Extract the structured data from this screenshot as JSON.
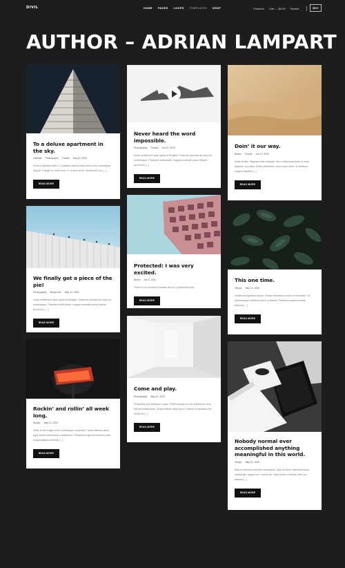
{
  "header": {
    "logo": "DIVIL",
    "nav": [
      "HOME",
      "PAGES",
      "LOOPS",
      "TEMPLATES",
      "SHOP"
    ],
    "right": [
      "Features",
      "Cart — $0.00",
      "Search"
    ],
    "buy": "BUY"
  },
  "page_title": "AUTHOR – ADRIAN LAMPART",
  "read_more": "READ MORE",
  "cards": [
    {
      "title": "To a deluxe apartment in the sky.",
      "meta": [
        "Lifestyle",
        "Photography",
        "Travels",
        "Aug 10, 2020"
      ],
      "excerpt": "Proin id gravida libero. Curabitur lacinia tellus sed purus consequat aliquet. Integer eu ante eros. In a arcu tortor. Vestibulum ac [...]"
    },
    {
      "title": "We finally got a piece of the pie!",
      "meta": [
        "Photography",
        "Simple Mix",
        "May 14, 2020"
      ],
      "excerpt": "Nulla vestibulum quis ligula at fringilla. Vivamus pulvinar ac risus ac scelerisque. Praesent sollicitudin, magna molestie porta finibus, purus leo [...]"
    },
    {
      "title": "Rockin’ and rollin’ all week long.",
      "meta": [
        "Design",
        "May 13, 2020"
      ],
      "excerpt": "Nulla id sem eget tortor scelerisque imperdiet. Nulla efficitur lacus eget lectus elementum vestibulum. Phasellus eget fermentum ante. Suspendisse vehicula [...]"
    },
    {
      "title": "Never heard the word impossible.",
      "meta": [
        "Photography",
        "Travels",
        "Jun 27, 2020"
      ],
      "excerpt": "Nulla vestibulum quis ligula at fringilla. Vivamus pulvinar ac risus ac scelerisque. Praesent sollicitudin, magna molestie porta finibus, purus leo [...]"
    },
    {
      "title": "Protected: I was very excited.",
      "meta": [
        "Books",
        "Jan 3, 2020"
      ],
      "excerpt": "There is no excerpt because this is a protected post."
    },
    {
      "title": "Come and play.",
      "meta": [
        "Photography",
        "May 12, 2020"
      ],
      "excerpt": "Phasellus sed interdum turpis. Pellentesque eu nisl bibendum arcu rutrum malesuada. Suspendisse vitae ipsum cursus in faucibus est luctus et [...]"
    },
    {
      "title": "Doin’ it our way.",
      "meta": [
        "Books",
        "Travels",
        "Jun 14, 2020"
      ],
      "excerpt": "Nulla facilisi. Aliquam erat volutpat. Sed malesuada justo in risus aliquam convallis. Etiam bibendum accumsan dolor, ut eleifend magna dapibus [...]"
    },
    {
      "title": "This one time.",
      "meta": [
        "Design",
        "May 14, 2020"
      ],
      "excerpt": "Nullam at egestas neque. Donec tincidunt ut arcu eu tincidunt. Ut pellentesque eleifend lorem a finibus. Praesent varius mauris tempus [...]"
    },
    {
      "title": "Nobody normal ever accomplished anything meaningful in this world.",
      "meta": [
        "Design",
        "May 11, 2020"
      ],
      "excerpt": "Mauris placerat ultricies consequat. Duis sit amet erat bibendum, sollicitudin neque non, luctus leo. Nam porta vehicula velit non ultrices [...]"
    }
  ]
}
